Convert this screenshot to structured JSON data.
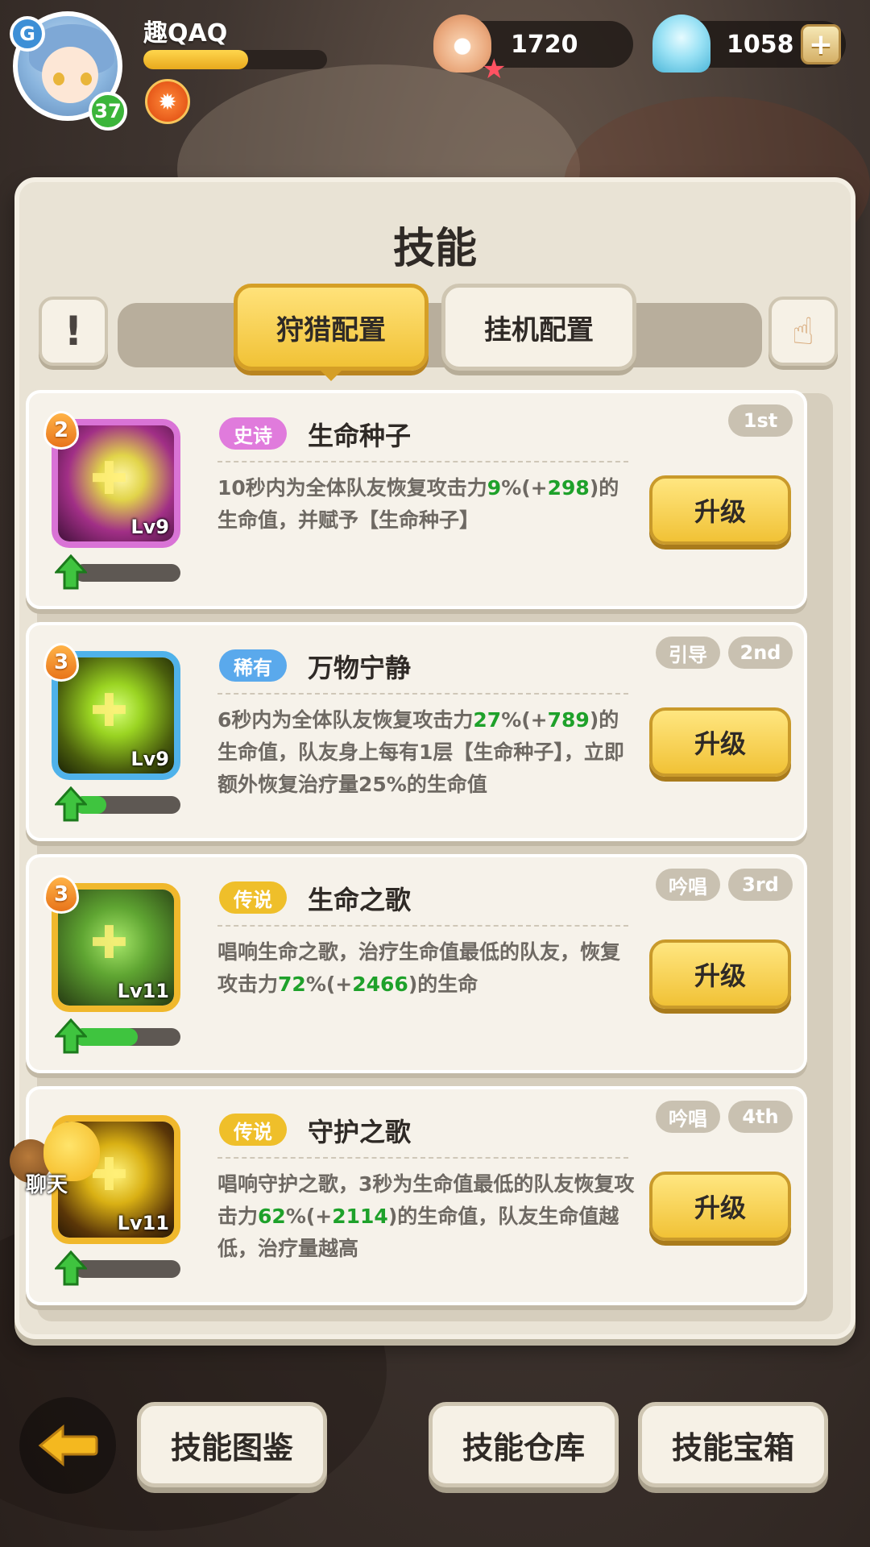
{
  "player": {
    "name": "趣QAQ",
    "level": "37",
    "exp_fraction": 0.57,
    "logo_letter": "G"
  },
  "currencies": {
    "pearl": "1720",
    "shell": "1058"
  },
  "panel": {
    "title": "技能",
    "info_label": "!",
    "tabs": [
      {
        "label": "狩猎配置",
        "active": true
      },
      {
        "label": "挂机配置",
        "active": false
      }
    ]
  },
  "skills": [
    {
      "drop": "2",
      "lv": "Lv9",
      "rarity": "史诗",
      "rarity_color": "#e07bdc",
      "name": "生命种子",
      "desc_parts": [
        "10秒内为全体队友恢复攻击力",
        "9",
        "%(+",
        "298",
        ")的生命值，并赋予【生命种子】"
      ],
      "tags": [
        "1st"
      ],
      "button": "升级",
      "progress": 0.0,
      "frame_color": "#d973d6",
      "icon_bg": "radial-gradient(circle at 55% 45%, #fff6a5 0%, #e1d44a 25%, #a12f86 60%, #41103a 100%)"
    },
    {
      "drop": "3",
      "lv": "Lv9",
      "rarity": "稀有",
      "rarity_color": "#5aa9ec",
      "name": "万物宁静",
      "desc_parts": [
        "6秒内为全体队友恢复攻击力",
        "27",
        "%(+",
        "789",
        ")的生命值，队友身上每有1层【生命种子】，立即额外恢复治疗量25%的生命值"
      ],
      "tags": [
        "引导",
        "2nd"
      ],
      "button": "升级",
      "progress": 0.3,
      "frame_color": "#4fb2ea",
      "icon_bg": "radial-gradient(circle at 50% 45%, #d7ff7a 0%, #9ad422 30%, #4a5e0d 70%, #1b2206 100%)"
    },
    {
      "drop": "3",
      "lv": "Lv11",
      "rarity": "传说",
      "rarity_color": "#efbf2a",
      "name": "生命之歌",
      "desc_parts": [
        "唱响生命之歌，治疗生命值最低的队友，恢复攻击力",
        "72",
        "%(+",
        "2466",
        ")的生命"
      ],
      "tags": [
        "吟唱",
        "3rd"
      ],
      "button": "升级",
      "progress": 0.6,
      "frame_color": "#f0b82c",
      "icon_bg": "radial-gradient(circle at 50% 45%, #a8e86a 0%, #5fa532 40%, #263a12 100%)"
    },
    {
      "drop": "",
      "lv": "Lv11",
      "rarity": "传说",
      "rarity_color": "#efbf2a",
      "name": "守护之歌",
      "desc_parts": [
        "唱响守护之歌，3秒为生命值最低的队友恢复攻击力",
        "62",
        "%(+",
        "2114",
        ")的生命值，队友生命值越低，治疗量越高"
      ],
      "tags": [
        "吟唱",
        "4th"
      ],
      "button": "升级",
      "progress": 0.0,
      "frame_color": "#f0b82c",
      "icon_bg": "radial-gradient(circle at 50% 45%, #fff27a 0%, #d9b014 35%, #5a3608 75%, #2b1a04 100%)"
    }
  ],
  "chat": {
    "label": "聊天"
  },
  "bottom": {
    "back_icon": "back-arrow-icon",
    "buttons": [
      "技能图鉴",
      "技能仓库",
      "技能宝箱"
    ]
  }
}
